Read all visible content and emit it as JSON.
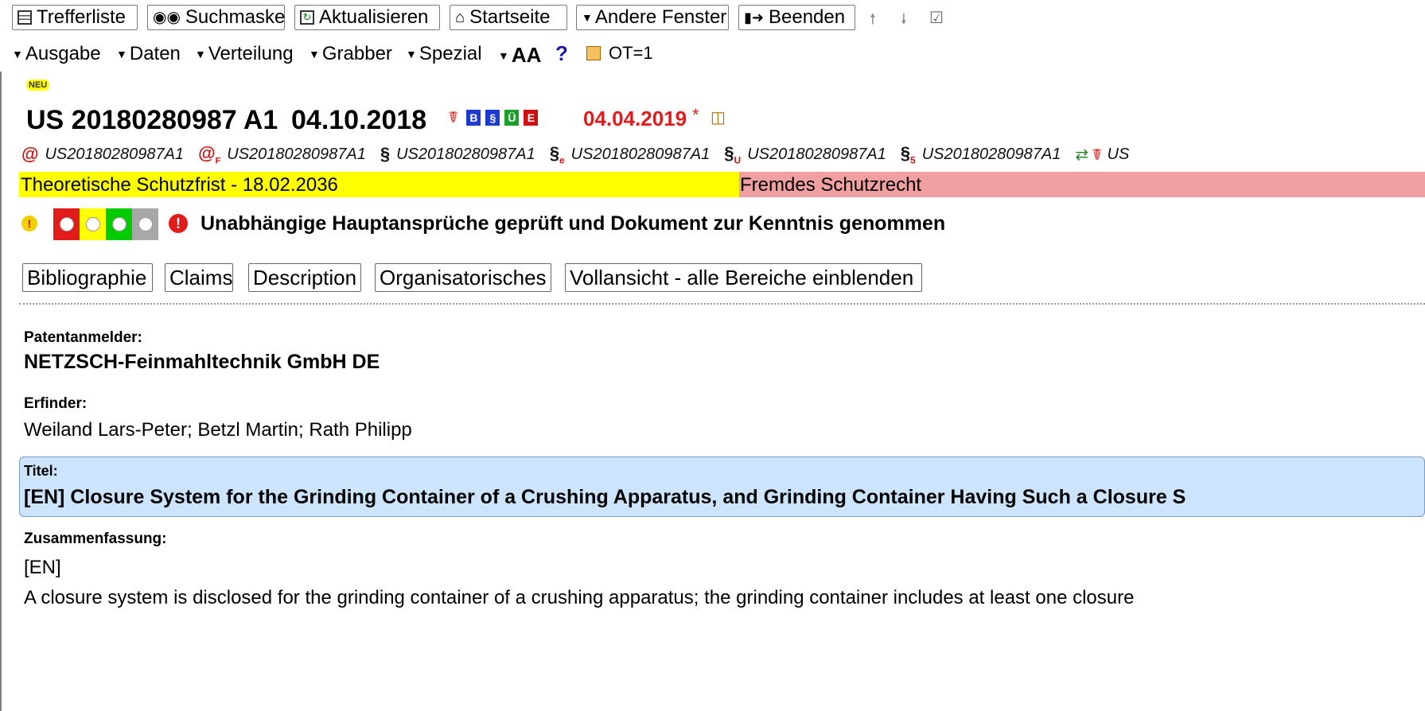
{
  "toolbar": {
    "trefferliste": "Trefferliste",
    "suchmaske": "Suchmaske",
    "aktualisieren": "Aktualisieren",
    "startseite": "Startseite",
    "andere_fenster": "Andere Fenster",
    "beenden": "Beenden"
  },
  "menu": {
    "ausgabe": "Ausgabe",
    "daten": "Daten",
    "verteilung": "Verteilung",
    "grabber": "Grabber",
    "spezial": "Spezial",
    "font_size": "AA",
    "help": "?",
    "ot": "OT=1"
  },
  "badge_new": "NEU",
  "document": {
    "number": "US 20180280987 A1",
    "date": "04.10.2018",
    "mini_icons": [
      "B",
      "§",
      "Ü",
      "E"
    ],
    "red_date": "04.04.2019",
    "asterisk": "*"
  },
  "refs": [
    {
      "symbol": "@",
      "id": "US20180280987A1"
    },
    {
      "symbol": "@",
      "sub": "F",
      "id": "US20180280987A1"
    },
    {
      "symbol": "§",
      "id": "US20180280987A1"
    },
    {
      "symbol": "§",
      "sub": "e",
      "id": "US20180280987A1"
    },
    {
      "symbol": "§",
      "sub": "U",
      "id": "US20180280987A1"
    },
    {
      "symbol": "§",
      "sub": "5",
      "id": "US20180280987A1"
    }
  ],
  "ref_trailing": "US",
  "status": {
    "schutzfrist": "Theoretische Schutzfrist - 18.02.2036",
    "fremd": "Fremdes Schutzrecht",
    "notice": "Unabhängige Hauptansprüche geprüft und Dokument zur Kenntnis genommen"
  },
  "sections": {
    "bibliographie": "Bibliographie",
    "claims": "Claims",
    "description": "Description",
    "organisatorisches": "Organisatorisches",
    "vollansicht": "Vollansicht - alle Bereiche einblenden"
  },
  "fields": {
    "anmelder_label": "Patentanmelder:",
    "anmelder_value": "NETZSCH-Feinmahltechnik GmbH DE",
    "erfinder_label": "Erfinder:",
    "erfinder_value": "Weiland Lars-Peter; Betzl Martin; Rath Philipp",
    "titel_label": "Titel:",
    "titel_value": "[EN] Closure System for the Grinding Container of a Crushing Apparatus, and Grinding Container Having Such a Closure S",
    "zusammenfassung_label": "Zusammenfassung:",
    "lang": "[EN]",
    "abstract": "A closure system is disclosed for the grinding container of a crushing apparatus; the grinding container includes at least one closure"
  },
  "colors": {
    "yellow": "#ffff00",
    "salmon": "#f0a0a0",
    "title_bg": "#cce4fc",
    "red": "#e31b1b",
    "green": "#00cc00",
    "gray": "#a8a8a8"
  },
  "icons": [
    "report-icon",
    "binoculars-icon",
    "refresh-icon",
    "home-icon",
    "dropdown-icon",
    "exit-door-icon",
    "arrow-up-icon",
    "arrow-down-icon",
    "checkbox-icon",
    "pdf-icon",
    "compare-icon",
    "alert-icon",
    "traffic-light-icon"
  ]
}
